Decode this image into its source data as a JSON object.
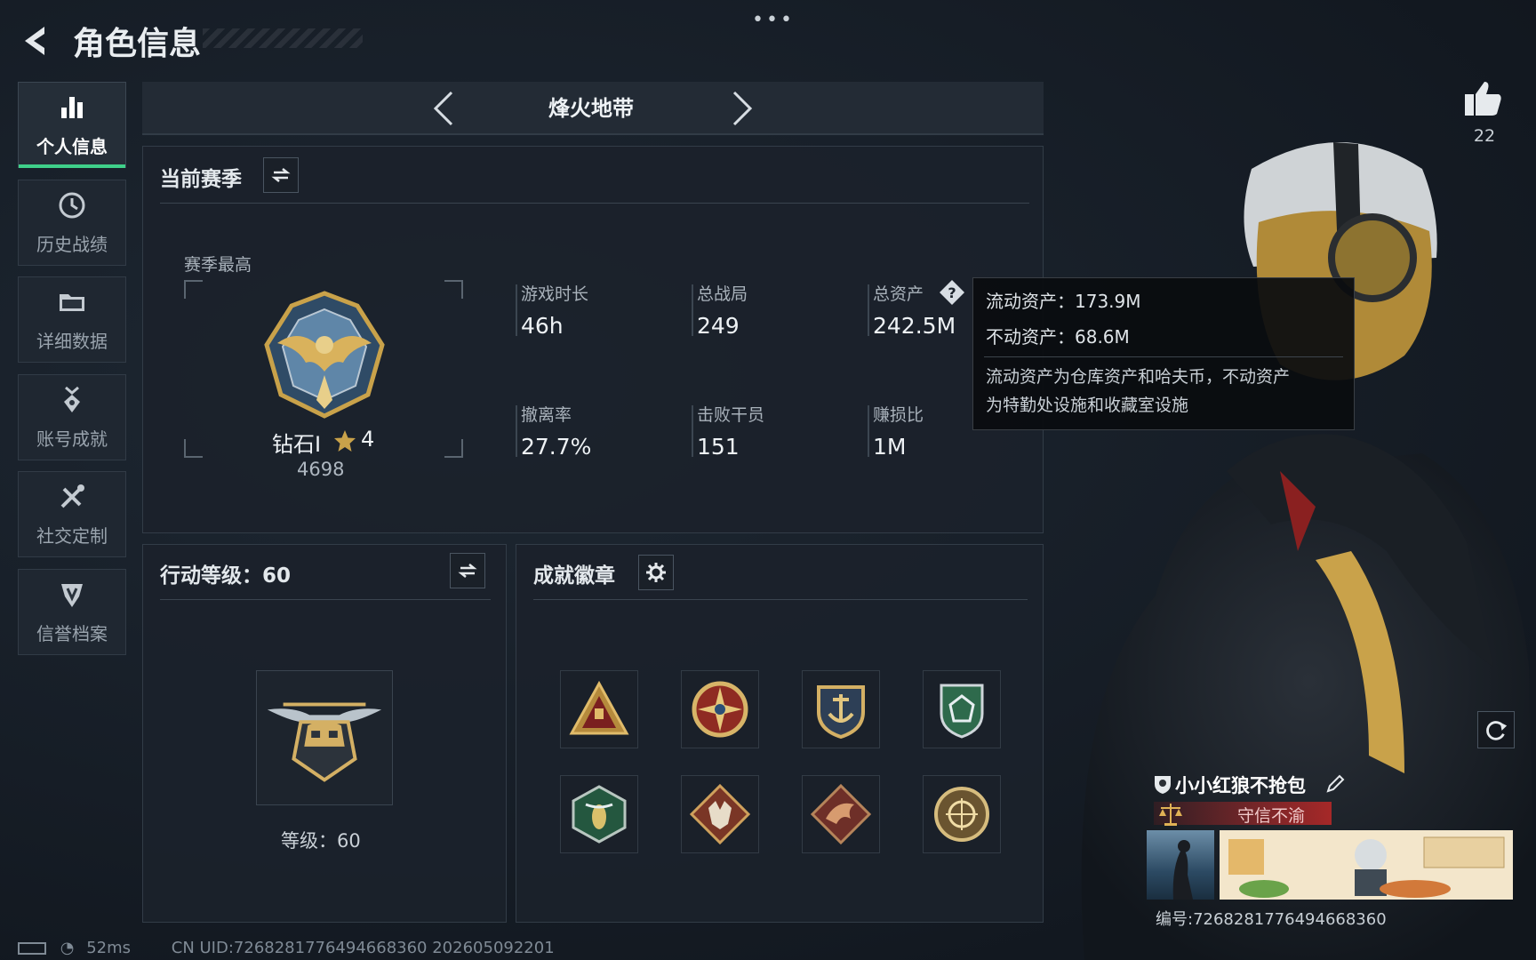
{
  "header": {
    "title": "角色信息",
    "dots": "•••"
  },
  "sidebar": {
    "items": [
      {
        "label": "个人信息",
        "icon": "bar-chart-icon",
        "active": true
      },
      {
        "label": "历史战绩",
        "icon": "clock-icon"
      },
      {
        "label": "详细数据",
        "icon": "folder-icon"
      },
      {
        "label": "账号成就",
        "icon": "medal-icon"
      },
      {
        "label": "社交定制",
        "icon": "tools-icon"
      },
      {
        "label": "信誉档案",
        "icon": "shield-icon"
      }
    ]
  },
  "mode_selector": {
    "title": "烽火地带"
  },
  "season": {
    "title": "当前赛季",
    "best_label": "赛季最高",
    "rank_name": "钻石Ⅰ",
    "rank_stars": "4",
    "rank_points": "4698",
    "stats": [
      {
        "label": "游戏时长",
        "value": "46h"
      },
      {
        "label": "总战局",
        "value": "249"
      },
      {
        "label": "总资产",
        "value": "242.5M"
      },
      {
        "label": "撤离率",
        "value": "27.7%"
      },
      {
        "label": "击败干员",
        "value": "151"
      },
      {
        "label": "赚损比",
        "value": "1M"
      }
    ]
  },
  "tooltip": {
    "liquid": "流动资产：173.9M",
    "fixed": "不动资产：68.6M",
    "desc_line1": "流动资产为仓库资产和哈夫币，不动资产",
    "desc_line2": "为特勤处设施和收藏室设施"
  },
  "action_level": {
    "title": "行动等级：60",
    "level_text": "等级：60"
  },
  "badges": {
    "title": "成就徽章",
    "items": [
      "warning-triangle-badge",
      "compass-star-badge",
      "anchor-shield-badge",
      "green-shield-badge",
      "hornet-hex-badge",
      "wolf-diamond-badge",
      "dragon-diamond-badge",
      "round-emblem-badge"
    ]
  },
  "profile": {
    "likes": "22",
    "player_name": "小小红狼不抢包",
    "reputation": "守信不渝",
    "serial": "编号:7268281776494668360"
  },
  "status_bar": {
    "ping": "52ms",
    "uid": "CN UID:7268281776494668360  202605092201"
  },
  "colors": {
    "accent_green": "#3fd08a",
    "gold": "#c9a24a",
    "panel": "#1b222b"
  }
}
